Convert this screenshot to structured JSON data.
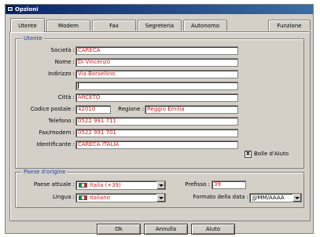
{
  "window": {
    "title": "Opzioni"
  },
  "tabs": [
    {
      "label": "Utente",
      "active": true
    },
    {
      "label": "Modem"
    },
    {
      "label": "Fax"
    },
    {
      "label": "Segreteria"
    },
    {
      "label": "Autonomo"
    },
    {
      "label": "Funzione"
    }
  ],
  "utente": {
    "group_title": "Utente",
    "societa": {
      "label": "Società :",
      "value": "CARECA"
    },
    "nome": {
      "label": "Nome :",
      "value": "Di Vincenzo"
    },
    "indirizzo": {
      "label": "Indirizzo :",
      "value": "Via Borsellino",
      "value2": ""
    },
    "citta": {
      "label": "Città :",
      "value": "ARCETO"
    },
    "codice_postale": {
      "label": "Codice postale :",
      "value": "42010"
    },
    "regione": {
      "label": "Regione :",
      "value": "Reggio Emilia"
    },
    "telefono": {
      "label": "Telefono :",
      "value": "0522 991 711"
    },
    "fax_modem": {
      "label": "Fax/modem :",
      "value": "0522 991 701"
    },
    "identificante": {
      "label": "Identificante :",
      "value": "CARECA ITALIA"
    },
    "bolle_aiuto": {
      "label": "Bolle d'Aiuto",
      "checked_mark": "X"
    }
  },
  "paese": {
    "group_title": "Paese d'origine",
    "paese_attuale": {
      "label": "Paese attuale :",
      "value": "Italia (+39)"
    },
    "lingua": {
      "label": "Lingua :",
      "value": "Italiano"
    },
    "prefisso": {
      "label": "Prefisso :",
      "value": "39"
    },
    "formato_data": {
      "label": "Formato della data :",
      "value": "JJ/MM/AAAA"
    },
    "flag_colors": [
      "#009246",
      "#ffffff",
      "#ce2b37"
    ]
  },
  "buttons": {
    "ok": "Ok",
    "annulla": "Annulla",
    "aiuto": "Aiuto"
  }
}
